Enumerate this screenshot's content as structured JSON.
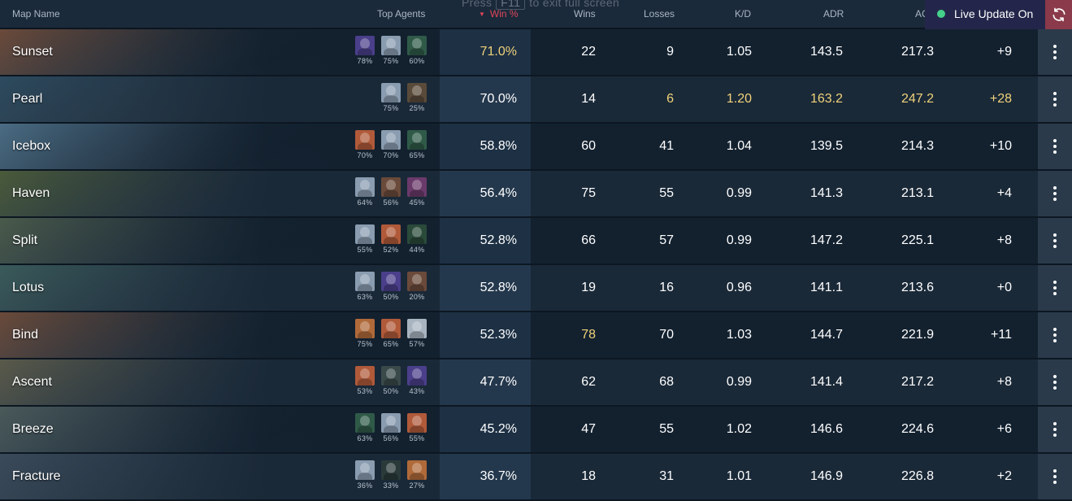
{
  "header": {
    "map_name": "Map Name",
    "top_agents": "Top Agents",
    "win_pct": "Win %",
    "wins": "Wins",
    "losses": "Losses",
    "kd": "K/D",
    "adr": "ADR",
    "acs": "AC",
    "sort_arrow": "▼"
  },
  "overlay": {
    "press": "Press",
    "key": "F11",
    "rest": "to exit full screen"
  },
  "live_update": {
    "label": "Live Update On",
    "status_color": "#45d18a"
  },
  "refresh_icon": "refresh-icon",
  "rows": [
    {
      "map": "Sunset",
      "bg": "#6b4a3a",
      "agents": [
        {
          "pct": "78%",
          "color": "#4a3f8a"
        },
        {
          "pct": "75%",
          "color": "#8a9cb0"
        },
        {
          "pct": "60%",
          "color": "#2f5a48"
        }
      ],
      "win": "71.0%",
      "wins": "22",
      "losses": "9",
      "kd": "1.05",
      "adr": "143.5",
      "acs": "217.3",
      "diff": "+9",
      "hl": [
        "win"
      ]
    },
    {
      "map": "Pearl",
      "bg": "#2d4a5e",
      "agents": [
        {
          "pct": "75%",
          "color": "#8a9cb0"
        },
        {
          "pct": "25%",
          "color": "#5a4a3a"
        }
      ],
      "win": "70.0%",
      "wins": "14",
      "losses": "6",
      "kd": "1.20",
      "adr": "163.2",
      "acs": "247.2",
      "diff": "+28",
      "hl": [
        "losses",
        "kd",
        "adr",
        "acs",
        "diff"
      ]
    },
    {
      "map": "Icebox",
      "bg": "#4a6c84",
      "agents": [
        {
          "pct": "70%",
          "color": "#b05a3a"
        },
        {
          "pct": "70%",
          "color": "#8a9cb0"
        },
        {
          "pct": "65%",
          "color": "#2f5a48"
        }
      ],
      "win": "58.8%",
      "wins": "60",
      "losses": "41",
      "kd": "1.04",
      "adr": "139.5",
      "acs": "214.3",
      "diff": "+10",
      "hl": []
    },
    {
      "map": "Haven",
      "bg": "#4a5a3a",
      "agents": [
        {
          "pct": "64%",
          "color": "#8a9cb0"
        },
        {
          "pct": "56%",
          "color": "#6a4a3a"
        },
        {
          "pct": "45%",
          "color": "#6a3a6a"
        }
      ],
      "win": "56.4%",
      "wins": "75",
      "losses": "55",
      "kd": "0.99",
      "adr": "141.3",
      "acs": "213.1",
      "diff": "+4",
      "hl": []
    },
    {
      "map": "Split",
      "bg": "#4a5a4a",
      "agents": [
        {
          "pct": "55%",
          "color": "#8a9cb0"
        },
        {
          "pct": "52%",
          "color": "#b05a3a"
        },
        {
          "pct": "44%",
          "color": "#2a4a3a"
        }
      ],
      "win": "52.8%",
      "wins": "66",
      "losses": "57",
      "kd": "0.99",
      "adr": "147.2",
      "acs": "225.1",
      "diff": "+8",
      "hl": []
    },
    {
      "map": "Lotus",
      "bg": "#3a5a5a",
      "agents": [
        {
          "pct": "63%",
          "color": "#8a9cb0"
        },
        {
          "pct": "50%",
          "color": "#4a3f8a"
        },
        {
          "pct": "20%",
          "color": "#6a4a3a"
        }
      ],
      "win": "52.8%",
      "wins": "19",
      "losses": "16",
      "kd": "0.96",
      "adr": "141.1",
      "acs": "213.6",
      "diff": "+0",
      "hl": []
    },
    {
      "map": "Bind",
      "bg": "#6a4a3a",
      "agents": [
        {
          "pct": "75%",
          "color": "#b06a3a"
        },
        {
          "pct": "65%",
          "color": "#b05a3a"
        },
        {
          "pct": "57%",
          "color": "#a8b4c0"
        }
      ],
      "win": "52.3%",
      "wins": "78",
      "losses": "70",
      "kd": "1.03",
      "adr": "144.7",
      "acs": "221.9",
      "diff": "+11",
      "hl": [
        "wins"
      ]
    },
    {
      "map": "Ascent",
      "bg": "#5a5a4a",
      "agents": [
        {
          "pct": "53%",
          "color": "#b05a3a"
        },
        {
          "pct": "50%",
          "color": "#3a4a4a"
        },
        {
          "pct": "43%",
          "color": "#4a3f8a"
        }
      ],
      "win": "47.7%",
      "wins": "62",
      "losses": "68",
      "kd": "0.99",
      "adr": "141.4",
      "acs": "217.2",
      "diff": "+8",
      "hl": []
    },
    {
      "map": "Breeze",
      "bg": "#4a5a5a",
      "agents": [
        {
          "pct": "63%",
          "color": "#2f5a48"
        },
        {
          "pct": "56%",
          "color": "#8a9cb0"
        },
        {
          "pct": "55%",
          "color": "#b05a3a"
        }
      ],
      "win": "45.2%",
      "wins": "47",
      "losses": "55",
      "kd": "1.02",
      "adr": "146.6",
      "acs": "224.6",
      "diff": "+6",
      "hl": []
    },
    {
      "map": "Fracture",
      "bg": "#3a4a5a",
      "agents": [
        {
          "pct": "36%",
          "color": "#8a9cb0"
        },
        {
          "pct": "33%",
          "color": "#2a3a3a"
        },
        {
          "pct": "27%",
          "color": "#b06a3a"
        }
      ],
      "win": "36.7%",
      "wins": "18",
      "losses": "31",
      "kd": "1.01",
      "adr": "146.9",
      "acs": "226.8",
      "diff": "+2",
      "hl": []
    }
  ]
}
